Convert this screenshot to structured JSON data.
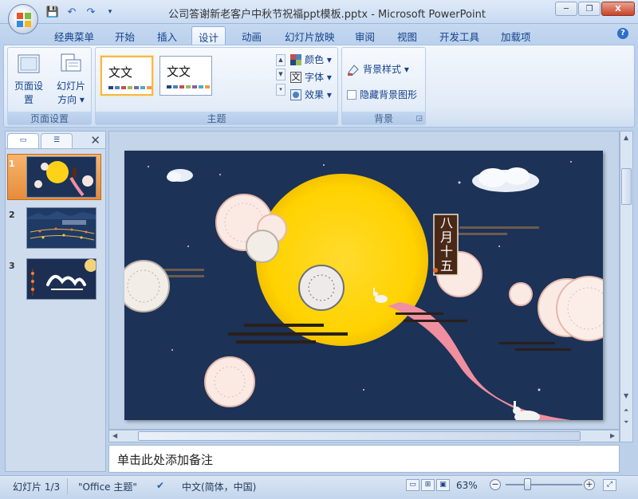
{
  "window": {
    "title": "公司答谢新老客户中秋节祝福ppt模板.pptx - Microsoft PowerPoint",
    "minimize": "─",
    "restore": "❐",
    "close": "X"
  },
  "qat": {
    "save": "💾",
    "undo": "↶",
    "redo": "↷",
    "more": "▾"
  },
  "tabs": [
    {
      "label": "经典菜单",
      "active": false
    },
    {
      "label": "开始",
      "active": false
    },
    {
      "label": "插入",
      "active": false
    },
    {
      "label": "设计",
      "active": true
    },
    {
      "label": "动画",
      "active": false
    },
    {
      "label": "幻灯片放映",
      "active": false
    },
    {
      "label": "审阅",
      "active": false
    },
    {
      "label": "视图",
      "active": false
    },
    {
      "label": "开发工具",
      "active": false
    },
    {
      "label": "加载项",
      "active": false
    }
  ],
  "help": "?",
  "ribbon": {
    "page_setup": {
      "group_label": "页面设置",
      "page_setup_btn": "页面设置",
      "orientation_btn_line1": "幻灯片",
      "orientation_btn_line2": "方向 ▾"
    },
    "themes": {
      "group_label": "主题",
      "thumb1_text": "文文",
      "thumb2_text": "文文",
      "colors": "颜色 ▾",
      "fonts": "字体 ▾",
      "effects": "效果 ▾"
    },
    "background": {
      "group_label": "背景",
      "styles": "背景样式 ▾",
      "hide_graphics": "隐藏背景图形",
      "hide_checked": false
    }
  },
  "slides_pane": {
    "close": "✕",
    "slides": [
      {
        "num": "1",
        "selected": true
      },
      {
        "num": "2",
        "selected": false
      },
      {
        "num": "3",
        "selected": false
      }
    ]
  },
  "slide": {
    "vertical_text": "八月十五"
  },
  "notes_placeholder": "单击此处添加备注",
  "status": {
    "slide_counter": "幻灯片 1/3",
    "theme": "\"Office 主题\"",
    "language": "中文(简体，中国)",
    "zoom": "63%",
    "zoom_percent": 63
  },
  "colors": {
    "slide_bg": "#1c3257",
    "moon": "#ffd21a",
    "road": "#ef8fa0",
    "selected_thumb": "#f4a24d"
  }
}
